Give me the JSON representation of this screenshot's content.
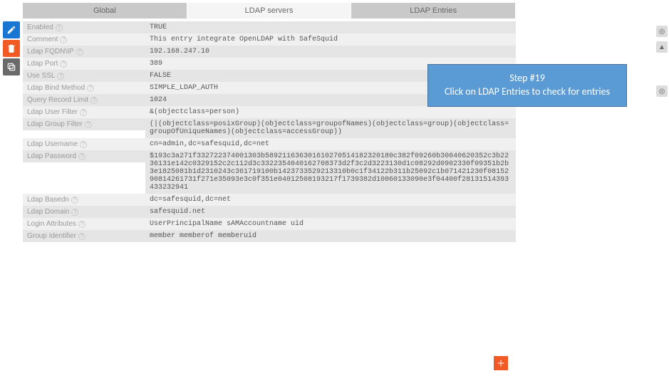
{
  "tabs": {
    "global": "Global",
    "servers": "LDAP servers",
    "entries": "LDAP Entries"
  },
  "fields": {
    "enabled": {
      "label": "Enabled",
      "value": "TRUE"
    },
    "comment": {
      "label": "Comment",
      "value": "This entry integrate OpenLDAP with SafeSquid"
    },
    "fqdn": {
      "label": "Ldap FQDN\\IP",
      "value": "192.168.247.10"
    },
    "port": {
      "label": "Ldap Port",
      "value": "389"
    },
    "ssl": {
      "label": "Use SSL",
      "value": "FALSE"
    },
    "bind": {
      "label": "Ldap Bind Method",
      "value": "SIMPLE_LDAP_AUTH"
    },
    "limit": {
      "label": "Query Record Limit",
      "value": "1024"
    },
    "userfilter": {
      "label": "Ldap User Filter",
      "value": "&(objectclass=person)"
    },
    "groupfilter": {
      "label": "Ldap Group Filter",
      "value": "(|(objectclass=posixGroup)(objectclass=groupofNames)(objectclass=group)(objectclass=groupOfUniqueNames)(objectclass=accessGroup))"
    },
    "username": {
      "label": "Ldap Username",
      "value": "cn=admin,dc=safesquid,dc=net"
    },
    "password": {
      "label": "Ldap Password",
      "value": "$193c3a271f332722374001303b589211636301610270514182320180c382f09260b30040620352c3b2236131e142c0329152c2c112d3c3322354040162708373d2f3c2d3223130d1c08292d0902330f09351b2b3e1825081b1d2310243c361719100b1423733529213310b0c1f34122b311b25092c1b071421230f0815290814261731f271e35093e3c0f351e04012508193217f1739382d10060133090e3f04400f28131514393433232941"
    },
    "basedn": {
      "label": "Ldap Basedn",
      "value": "dc=safesquid,dc=net"
    },
    "domain": {
      "label": "Ldap Domain",
      "value": "safesquid.net"
    },
    "loginattr": {
      "label": "Login Attributes",
      "value": "UserPrincipalName   sAMAccountname   uid"
    },
    "groupid": {
      "label": "Group Identifier",
      "value": "member   memberof   memberuid"
    }
  },
  "callout": {
    "title": "Step #19",
    "body": "Click on LDAP Entries to check for entries"
  }
}
